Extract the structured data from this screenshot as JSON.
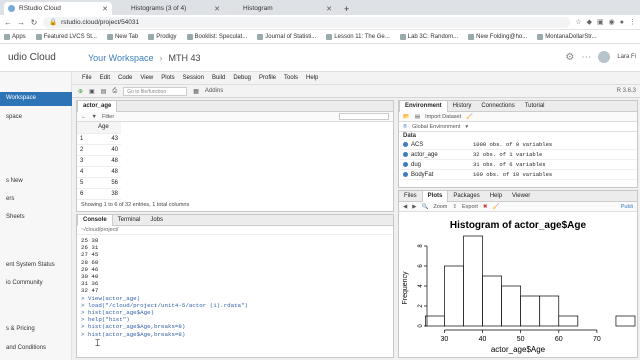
{
  "browser": {
    "tabs": [
      {
        "label": "RStudio Cloud",
        "active": true
      },
      {
        "label": "Histograms (3 of 4)",
        "active": false
      },
      {
        "label": "Histogram",
        "active": false
      }
    ],
    "new_tab": "+",
    "url": "rstudio.cloud/project/54031",
    "bookmarks": [
      "Apps",
      "Featured LVCS St...",
      "New Tab",
      "Prodigy",
      "Booklist: Speculat...",
      "Journal of Statisti...",
      "Lesson 11: The Ge...",
      "Lab 3C: Random...",
      "New Folding@ho...",
      "MontanaDollarStr..."
    ]
  },
  "cloud": {
    "brand": "udio Cloud",
    "breadcrumb": [
      "Your Workspace",
      "MTH 43"
    ],
    "sidebar": [
      {
        "label": "Workspace",
        "active": true
      },
      {
        "label": "space",
        "active": false
      },
      {
        "label": "s New",
        "active": false
      },
      {
        "label": "ers",
        "active": false
      },
      {
        "label": "Sheets",
        "active": false
      },
      {
        "label": "ent System Status",
        "active": false
      },
      {
        "label": "io Community",
        "active": false
      },
      {
        "label": "s & Pricing",
        "active": false
      },
      {
        "label": "and Conditions",
        "active": false
      }
    ],
    "user": "Lara Fi"
  },
  "ide": {
    "menu": [
      "File",
      "Edit",
      "Code",
      "View",
      "Plots",
      "Session",
      "Build",
      "Debug",
      "Profile",
      "Tools",
      "Help"
    ],
    "goto_placeholder": "Go to file/function",
    "addins": "Addins",
    "r_version": "R 3.6.3",
    "viewer": {
      "tab": "actor_age",
      "filter": "Filter",
      "column": "Age",
      "rows": [
        [
          "1",
          "43"
        ],
        [
          "2",
          "40"
        ],
        [
          "3",
          "48"
        ],
        [
          "4",
          "48"
        ],
        [
          "5",
          "56"
        ],
        [
          "6",
          "38"
        ]
      ],
      "footer": "Showing 1 to 6 of 32 entries, 1 total columns"
    },
    "console": {
      "tabs": [
        "Console",
        "Terminal",
        "Jobs"
      ],
      "path": "~/cloud/project/",
      "lines": [
        {
          "text": "25  38",
          "cmd": false
        },
        {
          "text": "26  31",
          "cmd": false
        },
        {
          "text": "27  45",
          "cmd": false
        },
        {
          "text": "28  60",
          "cmd": false
        },
        {
          "text": "29  46",
          "cmd": false
        },
        {
          "text": "30  40",
          "cmd": false
        },
        {
          "text": "31  36",
          "cmd": false
        },
        {
          "text": "32  47",
          "cmd": false
        },
        {
          "text": "> View(actor_age)",
          "cmd": true
        },
        {
          "text": "> load(\"/cloud/project/unit4-5/actor (1).rdata\")",
          "cmd": true
        },
        {
          "text": "> hist(actor_age$Age)",
          "cmd": true
        },
        {
          "text": "> help(\"hist\")",
          "cmd": true
        },
        {
          "text": "> hist(actor_age$Age,breaks=8)",
          "cmd": true
        },
        {
          "text": "> hist(actor_age$Age,breaks=8)",
          "cmd": true
        }
      ]
    },
    "env": {
      "tabs": [
        "Environment",
        "History",
        "Connections",
        "Tutorial"
      ],
      "import": "Import Dataset",
      "scope": "Global Environment",
      "section": "Data",
      "items": [
        {
          "name": "ACS",
          "value": "1000 obs. of 9 variables"
        },
        {
          "name": "actor_age",
          "value": "32 obs. of 1 variable"
        },
        {
          "name": "dug",
          "value": "31 obs. of 6 variables"
        },
        {
          "name": "BodyFat",
          "value": "100 obs. of 10 variables"
        }
      ]
    },
    "files": {
      "tabs": [
        "Files",
        "Plots",
        "Packages",
        "Help",
        "Viewer"
      ],
      "zoom": "Zoom",
      "export": "Export",
      "publish": "Publi"
    }
  },
  "chart_data": {
    "type": "bar",
    "title": "Histogram of actor_age$Age",
    "xlabel": "actor_age$Age",
    "ylabel": "Frequency",
    "bins": [
      [
        25,
        30
      ],
      [
        30,
        35
      ],
      [
        35,
        40
      ],
      [
        40,
        45
      ],
      [
        45,
        50
      ],
      [
        50,
        55
      ],
      [
        55,
        60
      ],
      [
        60,
        65
      ],
      [
        65,
        70
      ],
      [
        70,
        75
      ],
      [
        75,
        80
      ]
    ],
    "values": [
      1,
      6,
      9,
      5,
      4,
      3,
      3,
      1,
      0,
      0,
      1
    ],
    "xticks": [
      30,
      40,
      50,
      60,
      70
    ],
    "yticks": [
      0,
      2,
      4,
      6,
      8
    ],
    "xlim": [
      27,
      80
    ],
    "ylim": [
      0,
      9
    ]
  }
}
